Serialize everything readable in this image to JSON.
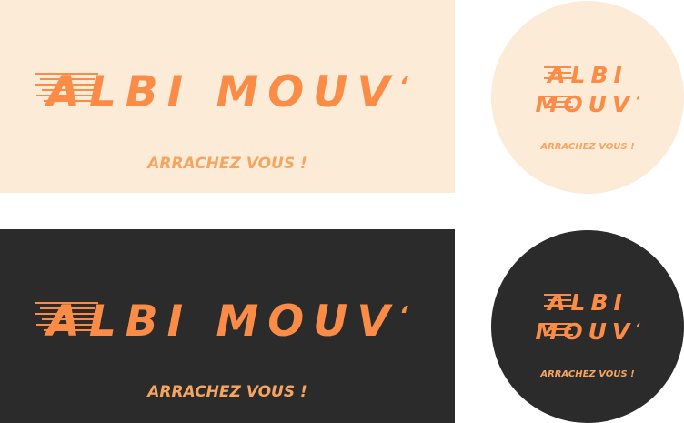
{
  "brand": {
    "line1": "ALBI MOUV",
    "line1_short_a": "ALBI",
    "line1_short_b": "MOUV",
    "mark": "‘",
    "tagline": "ARRACHEZ VOUS !"
  },
  "colors": {
    "light_bg": "#fbebd7",
    "dark_bg": "#2b2b2b",
    "logo_orange": "#fa8c48",
    "tagline_orange": "#f6a561"
  }
}
